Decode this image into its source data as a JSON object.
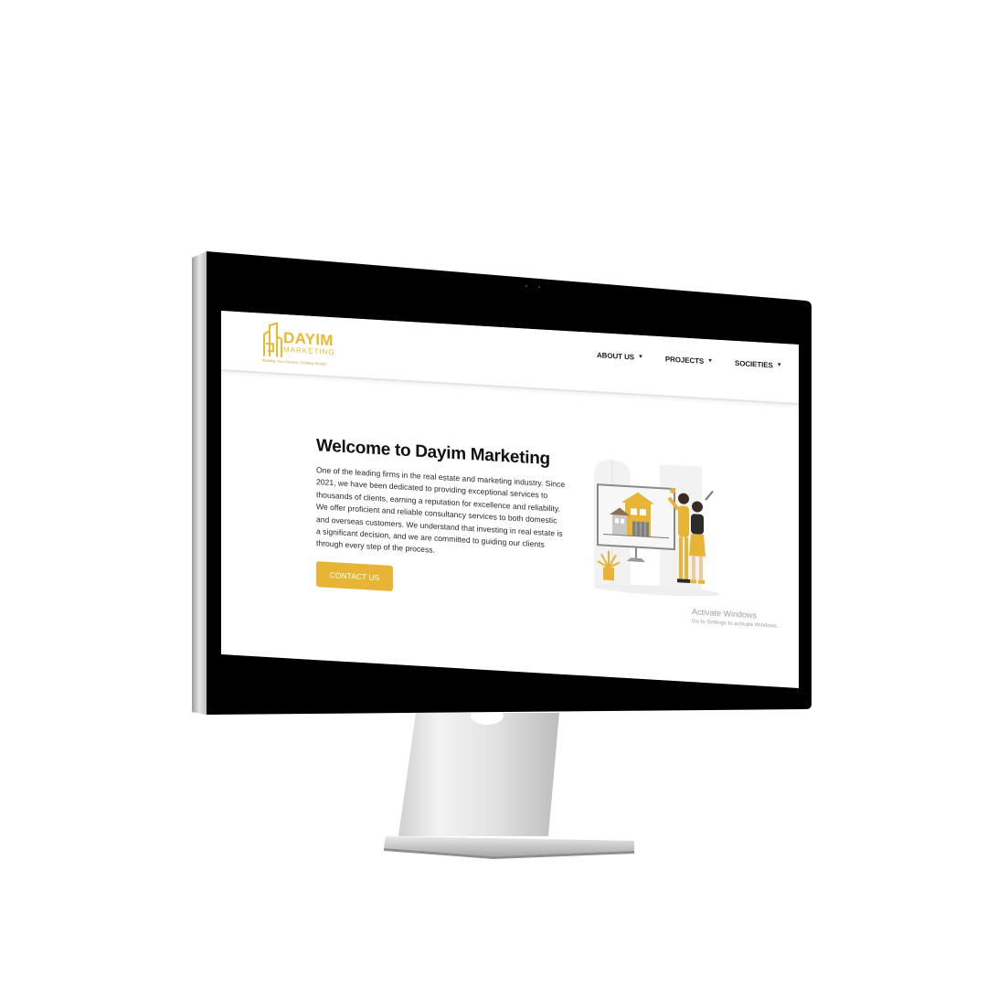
{
  "site": {
    "brand_name": "DAYIM",
    "brand_sub": "MARKETING",
    "tagline": "\"Building Your Dreams, Creating Reality\""
  },
  "nav": {
    "items": [
      {
        "label": "ABOUT US",
        "has_dropdown": true
      },
      {
        "label": "PROJECTS",
        "has_dropdown": true
      },
      {
        "label": "SOCIETIES",
        "has_dropdown": true
      }
    ]
  },
  "hero": {
    "title": "Welcome to Dayim Marketing",
    "paragraph": "One of the leading firms in the real estate and marketing industry. Since 2021, we have been dedicated to providing exceptional services to thousands of clients, earning a reputation for excellence and reliability. We offer proficient and reliable consultancy services to both domestic and overseas customers. We understand that investing in real estate is a significant decision, and we are committed to guiding our clients through every step of the process.",
    "cta_label": "CONTACT US"
  },
  "watermark": {
    "title": "Activate Windows",
    "subtitle": "Go to Settings to activate Windows."
  },
  "colors": {
    "accent": "#e7b436",
    "logo": "#e9b931",
    "text_dark": "#111111",
    "monitor_bezel": "#000000",
    "monitor_body": "#c9c9c9"
  },
  "icons": {
    "logo_mark": "building-logo-icon",
    "nav_caret": "caret-down-icon",
    "illustration": "house-couple-illustration"
  }
}
